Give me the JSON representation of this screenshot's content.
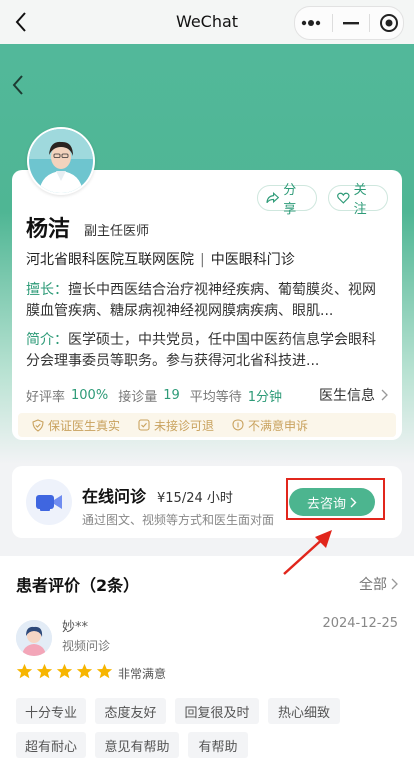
{
  "window": {
    "title": "WeChat"
  },
  "doctor": {
    "name": "杨洁",
    "rank": "副主任医师",
    "hospital": "河北省眼科医院互联网医院",
    "department": "中医眼科门诊",
    "share_label": "分享",
    "follow_label": "关注",
    "specialty_label": "擅长：",
    "specialty_text": "擅长中西医结合治疗视神经疾病、葡萄膜炎、视网膜血管疾病、糖尿病视神经视网膜病疾病、眼肌...",
    "intro_label": "简介：",
    "intro_text": "医学硕士，中共党员，任中国中医药信息学会眼科分会理事委员等职务。参与获得河北省科技进...",
    "stats": [
      {
        "label": "好评率",
        "value": "100%"
      },
      {
        "label": "接诊量",
        "value": "19"
      },
      {
        "label": "平均等待",
        "value": "1分钟"
      }
    ],
    "info_link": "医生信息",
    "guarantees": [
      "保证医生真实",
      "未接诊可退",
      "不满意申诉"
    ]
  },
  "consult": {
    "title": "在线问诊",
    "price": "¥15/24 小时",
    "description": "通过图文、视频等方式和医生面对面",
    "button_label": "去咨询"
  },
  "reviews": {
    "title": "患者评价（2条）",
    "all_label": "全部",
    "items": [
      {
        "user": "妙**",
        "type": "视频问诊",
        "date": "2024-12-25",
        "rating": 5,
        "satisfaction": "非常满意"
      }
    ],
    "tags": [
      "十分专业",
      "态度友好",
      "回复很及时",
      "热心细致",
      "超有耐心",
      "意见有帮助",
      "有帮助"
    ]
  },
  "colors": {
    "brand_green": "#4cb58f",
    "highlight_red": "#e1261c",
    "star_gold": "#f7b500",
    "guarantee_gold": "#c9a25e"
  },
  "icons": [
    "back-arrow-icon",
    "more-dots-icon",
    "minimize-icon",
    "close-target-icon",
    "share-icon",
    "heart-icon",
    "shield-icon",
    "check-icon",
    "complaint-icon",
    "video-camera-icon",
    "chevron-right-icon",
    "star-icon"
  ]
}
